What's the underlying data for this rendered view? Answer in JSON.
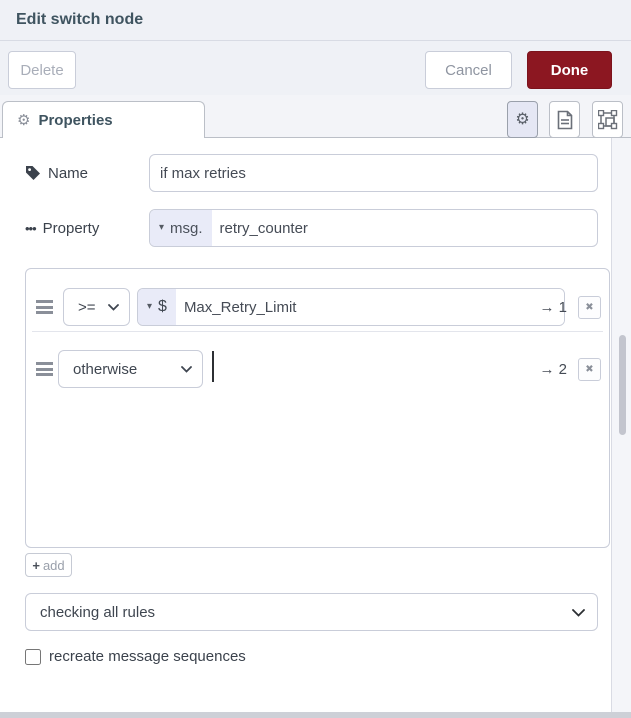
{
  "header": {
    "title": "Edit switch node"
  },
  "actions": {
    "delete": "Delete",
    "cancel": "Cancel",
    "done": "Done"
  },
  "tabs": {
    "properties": "Properties"
  },
  "icons": {
    "gear": "⚙",
    "ellipsis": "•••",
    "caret_down": "▾",
    "remove": "✖",
    "plus": "+"
  },
  "form": {
    "name_label": "Name",
    "name_value": "if max retries",
    "property_label": "Property",
    "property_prefix": "msg.",
    "property_value": "retry_counter",
    "rules": [
      {
        "operator": ">=",
        "type_prefix": "$",
        "value": "Max_Retry_Limit",
        "output_arrow": "→ 1"
      },
      {
        "operator": "otherwise",
        "output_arrow": "→ 2"
      }
    ],
    "add_label": "add",
    "rule_mode": "checking all rules",
    "recreate_label": "recreate message sequences"
  },
  "colors": {
    "done_button_bg": "#8c1721",
    "accent_lavender": "#e9ebf8",
    "header_bg": "#eff1f6"
  }
}
